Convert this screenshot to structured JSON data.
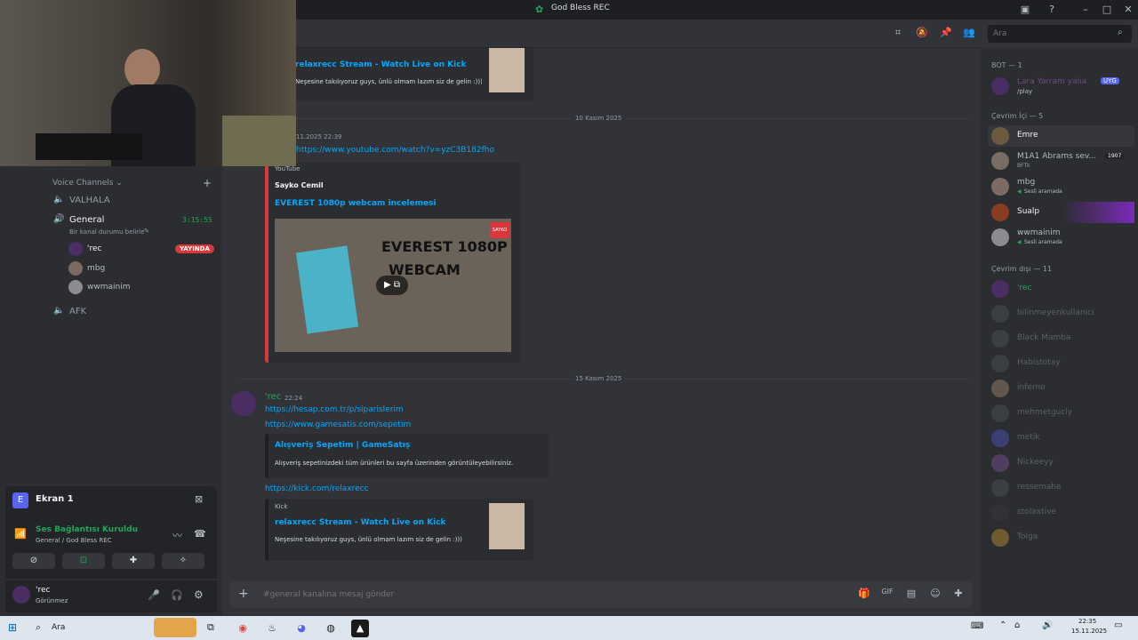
{
  "window": {
    "title": "God Bless REC"
  },
  "sidebar": {
    "category": "Voice Channels",
    "channels": [
      {
        "name": "VALHALA"
      },
      {
        "name": "General",
        "timer": "3:15:55",
        "status": "Bir kanal durumu belirle"
      },
      {
        "name": "AFK"
      }
    ],
    "voice_users": [
      {
        "name": "'rec",
        "badge": "YAYINDA"
      },
      {
        "name": "mbg"
      },
      {
        "name": "wwmainim"
      }
    ],
    "screen_share": {
      "label": "Ekran 1"
    },
    "voice_status": {
      "title": "Ses Bağlantısı Kuruldu",
      "subtitle": "General / God Bless REC"
    },
    "user": {
      "name": "'rec",
      "status": "Görünmez"
    }
  },
  "chat": {
    "messages_top": {
      "kick_title": "relaxrecc Stream - Watch Live on Kick",
      "kick_desc": "Neşesine takılıyoruz guys, ünlü olmam lazım siz de gelin :)))",
      "date1": "10 Kasım 2025",
      "time1": "11.2025 22:39",
      "yt_link": "https://www.youtube.com/watch?v=yzC3B182fho",
      "yt_provider": "YouTube",
      "yt_author": "Sayko Cemil",
      "yt_title": "EVEREST 1080p webcam incelemesi",
      "thumb_text1": "EVEREST 1080P",
      "thumb_text2": "WEBCAM",
      "thumb_brand": "SAYKO"
    },
    "date2": "15 Kasım 2025",
    "message": {
      "author": "'rec",
      "time": "22:24",
      "links": [
        "https://hesap.com.tr/p/siparislerim",
        "https://www.gamesatis.com/sepetim"
      ],
      "embed_title": "Alışveriş Sepetim | GameSatış",
      "embed_desc": "Alışveriş sepetinizdeki tüm ürünleri bu sayfa üzerinden görüntüleyebilirsiniz.",
      "kick_link": "https://kick.com/relaxrecc",
      "kick_provider": "Kick",
      "kick_title": "relaxrecc Stream - Watch Live on Kick",
      "kick_desc": "Neşesine takılıyoruz guys, ünlü olmam lazım siz de gelin :)))"
    },
    "input_placeholder": "#general kanalına mesaj gönder"
  },
  "search": {
    "placeholder": "Ara"
  },
  "members": {
    "bot_header": "BOT — 1",
    "bot": {
      "name": "Lara Yarram yalıa",
      "tag": "UYG",
      "activity": "/play"
    },
    "online_header": "Çevrim İçi — 5",
    "online": [
      {
        "name": "Emre"
      },
      {
        "name": "M1A1 Abrams sev...",
        "sub": "BFTk",
        "tag": "1907"
      },
      {
        "name": "mbg",
        "sub": "Sesli aramada"
      },
      {
        "name": "Sualp"
      },
      {
        "name": "wwmainim",
        "sub": "Sesli aramada"
      }
    ],
    "offline_header": "Çevrim dışı — 11",
    "offline": [
      {
        "name": "'rec"
      },
      {
        "name": "bilinmeyenkullanıcı"
      },
      {
        "name": "Black Mamba"
      },
      {
        "name": "Habistotay"
      },
      {
        "name": "inferno"
      },
      {
        "name": "mehmetgucly"
      },
      {
        "name": "metik"
      },
      {
        "name": "Nickeeyy"
      },
      {
        "name": "ressemahe"
      },
      {
        "name": "stolaxtive"
      },
      {
        "name": "Tolga"
      }
    ]
  },
  "taskbar": {
    "search": "Ara",
    "time": "22:35",
    "date": "15.11.2025"
  },
  "colors": {
    "accent": "#5865f2",
    "live": "#da373c",
    "green": "#23a55a",
    "link": "#00a8fc"
  }
}
